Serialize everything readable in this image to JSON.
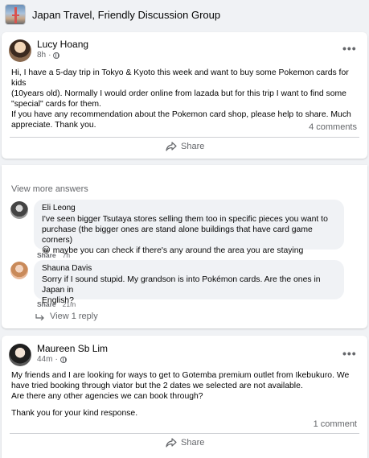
{
  "group": {
    "title": "Japan Travel, Friendly Discussion Group"
  },
  "post1": {
    "author": "Lucy Hoang",
    "time": "8h",
    "more_label": "•••",
    "lines": [
      "Hi, I have a 5-day trip in Tokyo & Kyoto this week and want to buy some Pokemon cards for kids",
      "(10years old). Normally I would order online from lazada but for this trip I want to find some",
      "\"special\" cards for them.",
      "If you have any recommendation about the Pokemon card shop, please help to share. Much",
      "appreciate. Thank you."
    ],
    "comment_count": "4 comments",
    "share_label": "Share"
  },
  "answers": {
    "view_more": "View more answers",
    "comments": [
      {
        "author": "Eli Leong",
        "lines": [
          "I've seen bigger Tsutaya stores selling them too in specific pieces you want to",
          "purchase (the bigger ones are stand alone buildings that have card game corners)",
          "😀 maybe you can check if there's any around the area you are staying"
        ],
        "action": "Share",
        "time": "7h"
      },
      {
        "author": "Shauna Davis",
        "lines": [
          "Sorry if I sound stupid. My grandson is into Pokémon cards. Are the ones in Japan in",
          "English?"
        ],
        "action": "Share",
        "time": "21m"
      }
    ],
    "view_reply": "View 1 reply"
  },
  "post2": {
    "author": "Maureen Sb Lim",
    "time": "44m",
    "more_label": "•••",
    "lines": [
      "My friends and I are looking for ways to get to Gotemba premium outlet from Ikebukuro. We",
      "have tried booking through viator but the 2 dates we selected are not available.",
      "Are there any other agencies we can book through?"
    ],
    "closing": "Thank you for your kind response.",
    "comment_count": "1 comment",
    "share_label": "Share"
  }
}
